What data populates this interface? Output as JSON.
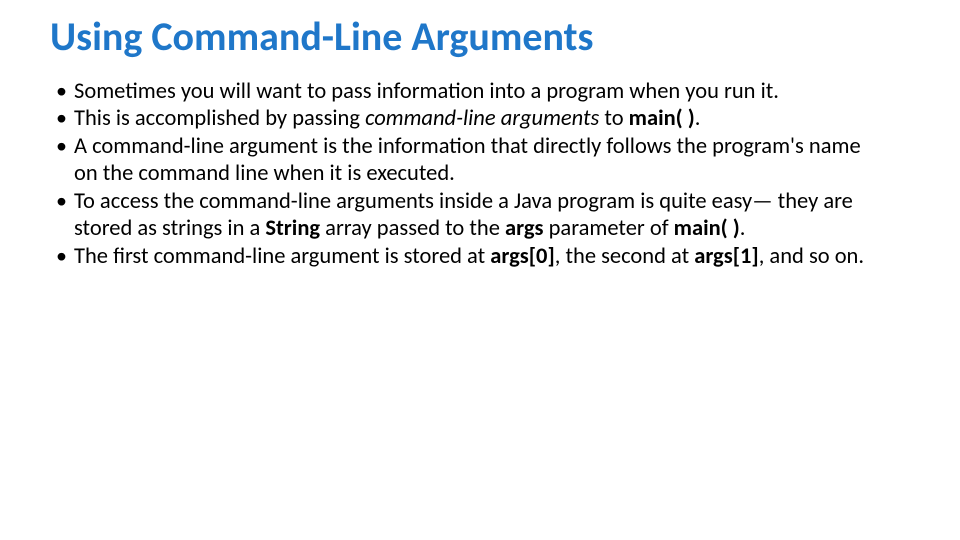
{
  "slide": {
    "title": "Using Command-Line Arguments",
    "bullets": [
      {
        "runs": [
          {
            "t": "Sometimes you will want to pass information into a program when you run it."
          }
        ]
      },
      {
        "runs": [
          {
            "t": "This is accomplished by passing "
          },
          {
            "t": "command-line arguments",
            "style": "i"
          },
          {
            "t": " to "
          },
          {
            "t": "main( )",
            "style": "b"
          },
          {
            "t": "."
          }
        ]
      },
      {
        "runs": [
          {
            "t": "A command-line argument is the information that directly follows the program's name on the command line when it is executed."
          }
        ]
      },
      {
        "runs": [
          {
            "t": "To access the command-line arguments inside a Java program is quite easy— they are stored as strings in a "
          },
          {
            "t": "String",
            "style": "b"
          },
          {
            "t": " array passed to the "
          },
          {
            "t": "args",
            "style": "b"
          },
          {
            "t": " parameter of "
          },
          {
            "t": "main( )",
            "style": "b"
          },
          {
            "t": "."
          }
        ]
      },
      {
        "runs": [
          {
            "t": "The first command-line argument is stored at "
          },
          {
            "t": "args[0]",
            "style": "b"
          },
          {
            "t": ", the second at "
          },
          {
            "t": "args[1]",
            "style": "b"
          },
          {
            "t": ", and so on."
          }
        ]
      }
    ]
  }
}
